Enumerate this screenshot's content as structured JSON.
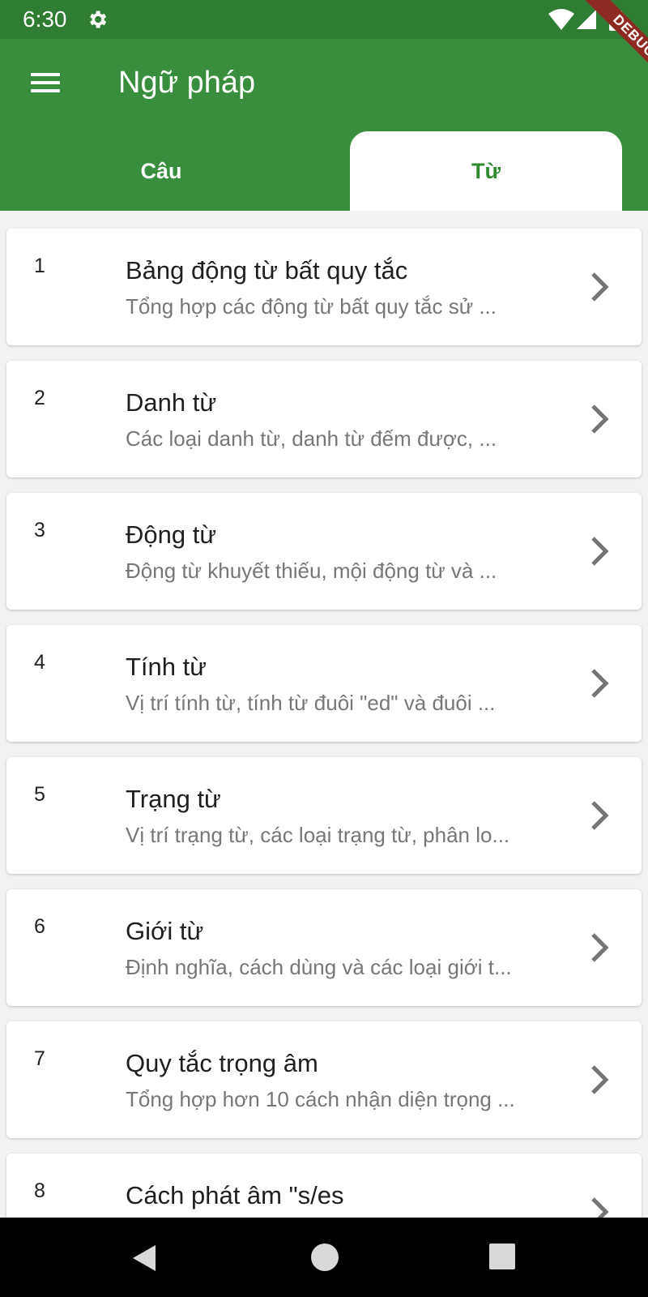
{
  "status_bar": {
    "time": "6:30",
    "icons": [
      "gear-icon",
      "wifi-icon",
      "signal-icon",
      "battery-icon"
    ]
  },
  "debug_banner": "DEBUG",
  "app_bar": {
    "title": "Ngữ pháp",
    "menu_icon": "menu-icon",
    "tabs": [
      {
        "label": "Câu",
        "selected": false
      },
      {
        "label": "Từ",
        "selected": true
      }
    ]
  },
  "colors": {
    "app_bar": "#388e3c",
    "status_bar": "#2e7d32",
    "selected_tab_text": "#2e8b2e",
    "background": "#f2f2f2"
  },
  "items": [
    {
      "number": "1",
      "title": "Bảng động từ bất quy tắc",
      "subtitle": "Tổng hợp các động từ bất quy tắc sử ..."
    },
    {
      "number": "2",
      "title": "Danh từ",
      "subtitle": "Các loại danh từ, danh từ đếm được, ..."
    },
    {
      "number": "3",
      "title": "Động từ",
      "subtitle": "Động từ khuyết thiếu, mội động từ và ..."
    },
    {
      "number": "4",
      "title": "Tính từ",
      "subtitle": "Vị trí tính từ, tính từ đuôi \"ed\" và đuôi ..."
    },
    {
      "number": "5",
      "title": "Trạng từ",
      "subtitle": "Vị trí trạng từ, các loại trạng từ, phân lo..."
    },
    {
      "number": "6",
      "title": "Giới từ",
      "subtitle": "Định nghĩa, cách dùng và các loại giới t..."
    },
    {
      "number": "7",
      "title": "Quy tắc trọng âm",
      "subtitle": "Tổng hợp hơn 10 cách nhận diện trọng ..."
    },
    {
      "number": "8",
      "title": "Cách phát âm \"s/es",
      "subtitle": ""
    }
  ],
  "nav_bar": {
    "icons": [
      "back-icon",
      "home-icon",
      "recent-apps-icon"
    ]
  }
}
